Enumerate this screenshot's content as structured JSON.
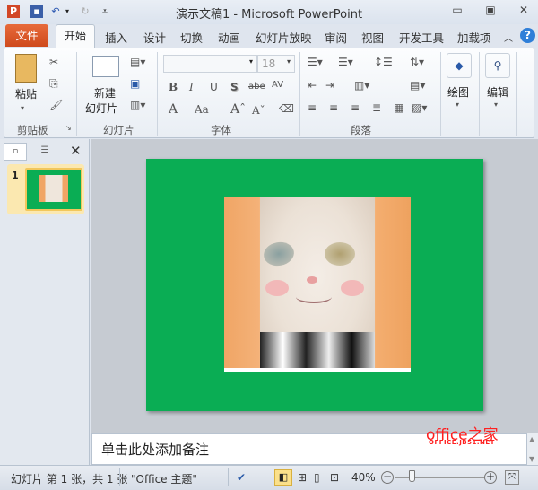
{
  "window": {
    "title": "演示文稿1 - Microsoft PowerPoint",
    "app_icon": "P",
    "minimize": "▭",
    "maximize": "▣",
    "close": "✕"
  },
  "quick_access": {
    "save": "save-icon",
    "undo": "undo-icon",
    "redo": "redo-icon",
    "customize": "customize-icon"
  },
  "tabs": [
    {
      "label": "文件"
    },
    {
      "label": "开始"
    },
    {
      "label": "插入"
    },
    {
      "label": "设计"
    },
    {
      "label": "切换"
    },
    {
      "label": "动画"
    },
    {
      "label": "幻灯片放映"
    },
    {
      "label": "审阅"
    },
    {
      "label": "视图"
    },
    {
      "label": "开发工具"
    },
    {
      "label": "加载项"
    }
  ],
  "help": "?",
  "ribbon": {
    "clipboard": {
      "label": "剪贴板",
      "paste": "粘贴"
    },
    "slides": {
      "label": "幻灯片",
      "new_slide_line1": "新建",
      "new_slide_line2": "幻灯片"
    },
    "font": {
      "label": "字体",
      "font_name": "",
      "font_size": "18",
      "bold": "B",
      "italic": "I",
      "underline": "U",
      "shadow": "S",
      "strike": "abe",
      "spacing": "AV",
      "color": "A",
      "case": "Aa",
      "grow": "Aˆ",
      "shrink": "Aˇ"
    },
    "paragraph": {
      "label": "段落"
    },
    "drawing": {
      "label": "绘图"
    },
    "editing": {
      "label": "编辑"
    }
  },
  "slide_pane": {
    "slide_number": "1"
  },
  "notes": {
    "placeholder": "单击此处添加备注"
  },
  "status": {
    "slide_info": "幻灯片 第 1 张，共 1 张",
    "theme": "\"Office 主题\"",
    "zoom": "40%",
    "zoom_level": 40
  },
  "watermark": {
    "text": "office之家",
    "url": "OFFICE.JB51.NET"
  },
  "colors": {
    "slide_bg": "#0aad54",
    "file_tab": "#d9542a"
  }
}
